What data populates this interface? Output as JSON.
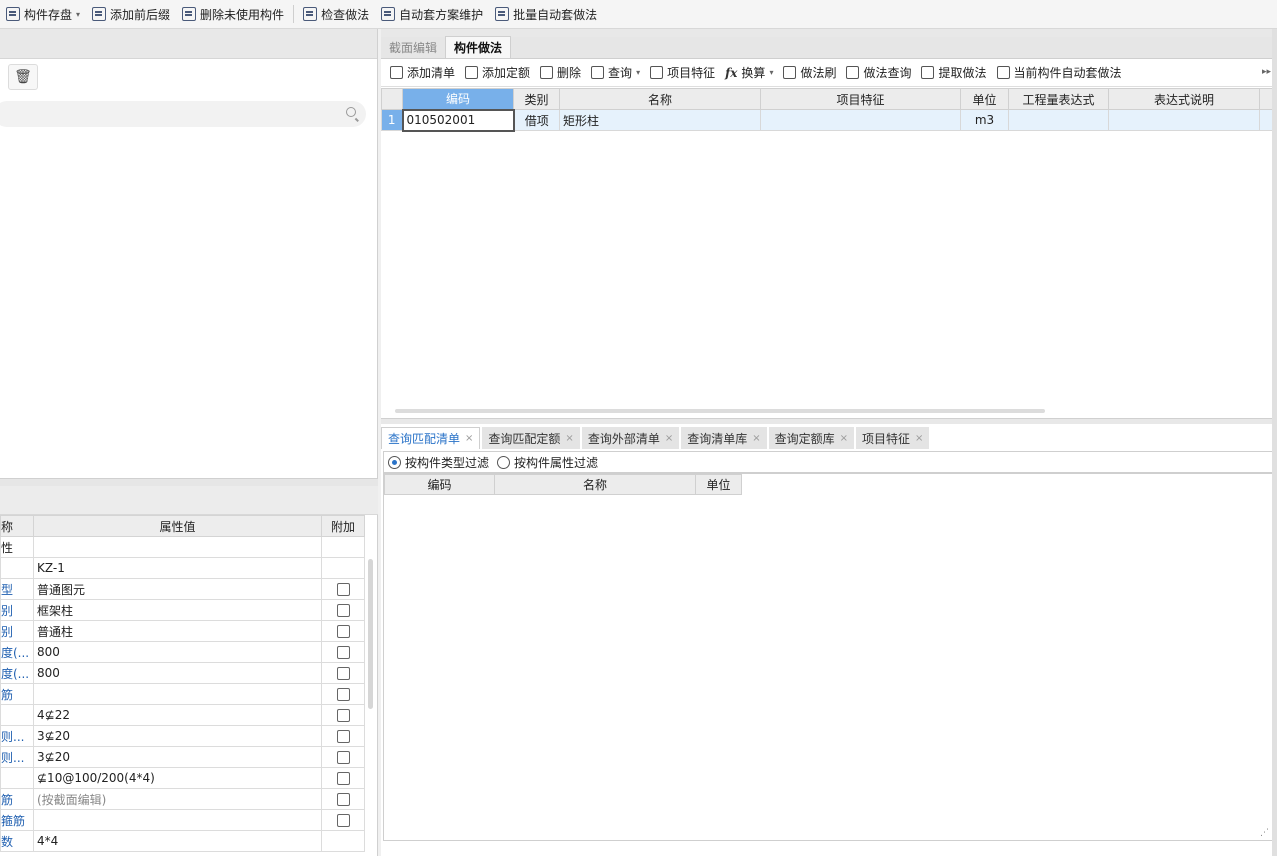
{
  "toolbar": {
    "items": [
      {
        "label": "构件存盘",
        "caret": "▾"
      },
      {
        "label": "添加前后缀"
      },
      {
        "label": "删除未使用构件"
      },
      {
        "label": "检查做法"
      },
      {
        "label": "自动套方案维护"
      },
      {
        "label": "批量自动套做法"
      }
    ]
  },
  "left": {
    "trash_icon": "🗑",
    "properties": {
      "headers": [
        "称",
        "属性值",
        "附加"
      ],
      "rows": [
        {
          "name": "性",
          "value": "",
          "check": false
        },
        {
          "name": "",
          "value": "KZ-1",
          "check": false
        },
        {
          "name": "型",
          "value": "普通图元",
          "check": true
        },
        {
          "name": "别",
          "value": "框架柱",
          "check": true
        },
        {
          "name": "别",
          "value": "普通柱",
          "check": true
        },
        {
          "name": "度(...",
          "value": "800",
          "check": true
        },
        {
          "name": "度(...",
          "value": "800",
          "check": true
        },
        {
          "name": "筋",
          "value": "",
          "check": true
        },
        {
          "name": "",
          "value": "4⊈22",
          "check": true
        },
        {
          "name": "则...",
          "value": "3⊈20",
          "check": true
        },
        {
          "name": "则...",
          "value": "3⊈20",
          "check": true
        },
        {
          "name": "",
          "value": "⊈10@100/200(4*4)",
          "check": true
        },
        {
          "name": "筋",
          "value": "(按截面编辑)",
          "check": true,
          "gray": true
        },
        {
          "name": "箍筋",
          "value": "",
          "check": true
        },
        {
          "name": "数",
          "value": "4*4",
          "check": false
        }
      ]
    }
  },
  "right": {
    "tabs": [
      "截面编辑",
      "构件做法"
    ],
    "active_tab": "构件做法",
    "toolbar": [
      {
        "label": "添加清单"
      },
      {
        "label": "添加定额"
      },
      {
        "label": "删除"
      },
      {
        "label": "查询",
        "caret": "▾"
      },
      {
        "label": "项目特征"
      },
      {
        "label": "换算",
        "caret": "▾",
        "fx": "fx"
      },
      {
        "label": "做法刷"
      },
      {
        "label": "做法查询"
      },
      {
        "label": "提取做法"
      },
      {
        "label": "当前构件自动套做法"
      }
    ],
    "more": "▸▸",
    "grid": {
      "headers": [
        "编码",
        "类别",
        "名称",
        "项目特征",
        "单位",
        "工程量表达式",
        "表达式说明"
      ],
      "rows": [
        {
          "num": "1",
          "code": "010502001",
          "type": "借项",
          "name": "矩形柱",
          "feature": "",
          "unit": "m3",
          "expr": "",
          "desc": ""
        }
      ]
    },
    "bottom_tabs": [
      {
        "label": "查询匹配清单"
      },
      {
        "label": "查询匹配定额"
      },
      {
        "label": "查询外部清单"
      },
      {
        "label": "查询清单库"
      },
      {
        "label": "查询定额库"
      },
      {
        "label": "项目特征"
      }
    ],
    "close_glyph": "×",
    "filters": [
      {
        "label": "按构件类型过滤",
        "checked": true
      },
      {
        "label": "按构件属性过滤",
        "checked": false
      }
    ],
    "query_headers": [
      "编码",
      "名称",
      "单位"
    ],
    "grip": "⋰"
  }
}
